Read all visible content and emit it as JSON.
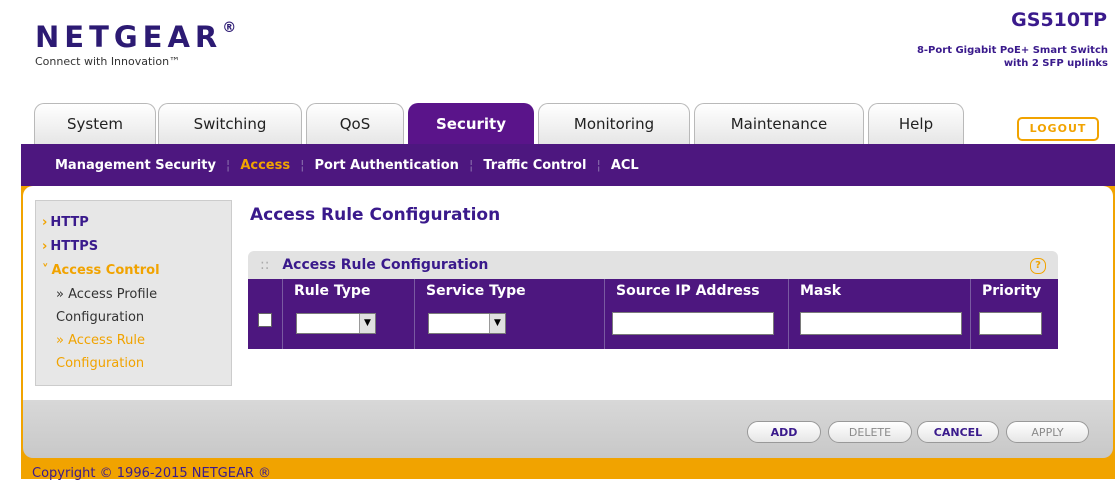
{
  "brand": {
    "logo": "NETGEAR",
    "logo_mark": "®",
    "tagline": "Connect with Innovation™"
  },
  "device": {
    "model": "GS510TP",
    "description": "8-Port Gigabit PoE+ Smart Switch\nwith 2 SFP uplinks"
  },
  "tabs": [
    {
      "label": "System"
    },
    {
      "label": "Switching"
    },
    {
      "label": "QoS"
    },
    {
      "label": "Security",
      "active": true
    },
    {
      "label": "Monitoring"
    },
    {
      "label": "Maintenance"
    },
    {
      "label": "Help"
    }
  ],
  "logout": "LOGOUT",
  "subnav": [
    {
      "label": "Management Security"
    },
    {
      "label": "Access",
      "active": true
    },
    {
      "label": "Port Authentication"
    },
    {
      "label": "Traffic Control"
    },
    {
      "label": "ACL"
    }
  ],
  "subnav_separator": "¦",
  "sidebar": {
    "items": [
      {
        "label": "HTTP"
      },
      {
        "label": "HTTPS"
      },
      {
        "label": "Access Control"
      }
    ],
    "subitems": [
      {
        "line1": "» Access Profile",
        "line2": "Configuration"
      },
      {
        "line1": "» Access Rule",
        "line2": "Configuration"
      }
    ]
  },
  "page_title": "Access Rule Configuration",
  "panel": {
    "title": "Access Rule Configuration",
    "help": "?",
    "columns": [
      "Rule Type",
      "Service Type",
      "Source IP Address",
      "Mask",
      "Priority"
    ],
    "row": {
      "rule_type": "",
      "service_type": "",
      "source_ip": "",
      "mask": "",
      "priority": ""
    }
  },
  "buttons": {
    "add": "ADD",
    "delete": "DELETE",
    "cancel": "CANCEL",
    "apply": "APPLY"
  },
  "copyright": "Copyright © 1996-2015 NETGEAR ®",
  "colors": {
    "accent": "#f1a300",
    "brand_purple": "#4d177f"
  }
}
